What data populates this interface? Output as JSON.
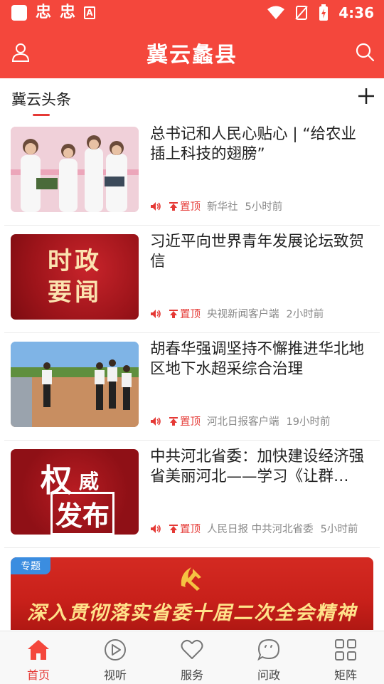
{
  "status_bar": {
    "time": "4:36",
    "app_badge": "A"
  },
  "header": {
    "title": "冀云蠡县"
  },
  "tabs": {
    "active": "冀云头条"
  },
  "thumb_labels": {
    "politics": [
      "时政",
      "要闻"
    ],
    "authority": [
      "权",
      "威",
      "发布"
    ]
  },
  "news": [
    {
      "title": "总书记和人民心贴心 | “给农业插上科技的翅膀”",
      "pin": "置顶",
      "source": "新华社",
      "time": "5小时前",
      "thumb": "lab-researchers"
    },
    {
      "title": "习近平向世界青年发展论坛致贺信",
      "pin": "置顶",
      "source": "央视新闻客户端",
      "time": "2小时前",
      "thumb": "politics-news-card"
    },
    {
      "title": "胡春华强调坚持不懈推进华北地区地下水超采综合治理",
      "pin": "置顶",
      "source": "河北日报客户端",
      "time": "19小时前",
      "thumb": "outdoor-inspection"
    },
    {
      "title": "中共河北省委：加快建设经济强省美丽河北——学习《让群…",
      "pin": "置顶",
      "source": "人民日报 中共河北省委",
      "time": "5小时前",
      "thumb": "authority-release-card"
    }
  ],
  "banner": {
    "tag": "专题",
    "text": "深入贯彻落实省委十届二次全会精神"
  },
  "bottom_nav": [
    {
      "label": "首页",
      "icon": "home-icon",
      "active": true
    },
    {
      "label": "视听",
      "icon": "play-icon",
      "active": false
    },
    {
      "label": "服务",
      "icon": "heart-icon",
      "active": false
    },
    {
      "label": "问政",
      "icon": "chat-icon",
      "active": false
    },
    {
      "label": "矩阵",
      "icon": "grid-icon",
      "active": false
    }
  ],
  "colors": {
    "brand": "#f4473c",
    "accent": "#e53935",
    "banner_text": "#ffe28a",
    "tag_blue": "#3b8de0"
  }
}
